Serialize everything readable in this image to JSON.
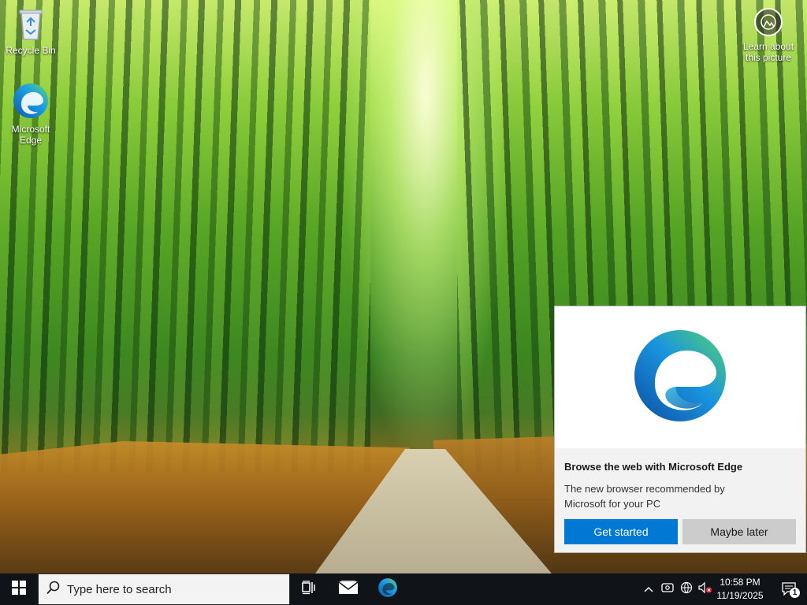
{
  "desktop": {
    "icons": [
      {
        "label": "Recycle Bin",
        "icon": "recycle-bin-icon"
      },
      {
        "label": "Microsoft Edge",
        "icon": "edge-icon"
      }
    ],
    "learn_about": "Learn about this picture"
  },
  "flyout": {
    "title": "Browse the web with Microsoft Edge",
    "text": "The new browser recommended by Microsoft for your PC",
    "primary_button": "Get started",
    "secondary_button": "Maybe later",
    "accent": "#0078d4"
  },
  "taskbar": {
    "search_placeholder": "Type here to search",
    "time": "10:58 PM",
    "date": "11/19/2025",
    "notification_count": "1",
    "pinned": [
      "task-view-icon",
      "mail-icon",
      "edge-icon"
    ],
    "tray_icons": [
      "chevron-up-icon",
      "meet-now-icon",
      "network-icon",
      "volume-muted-icon"
    ]
  }
}
